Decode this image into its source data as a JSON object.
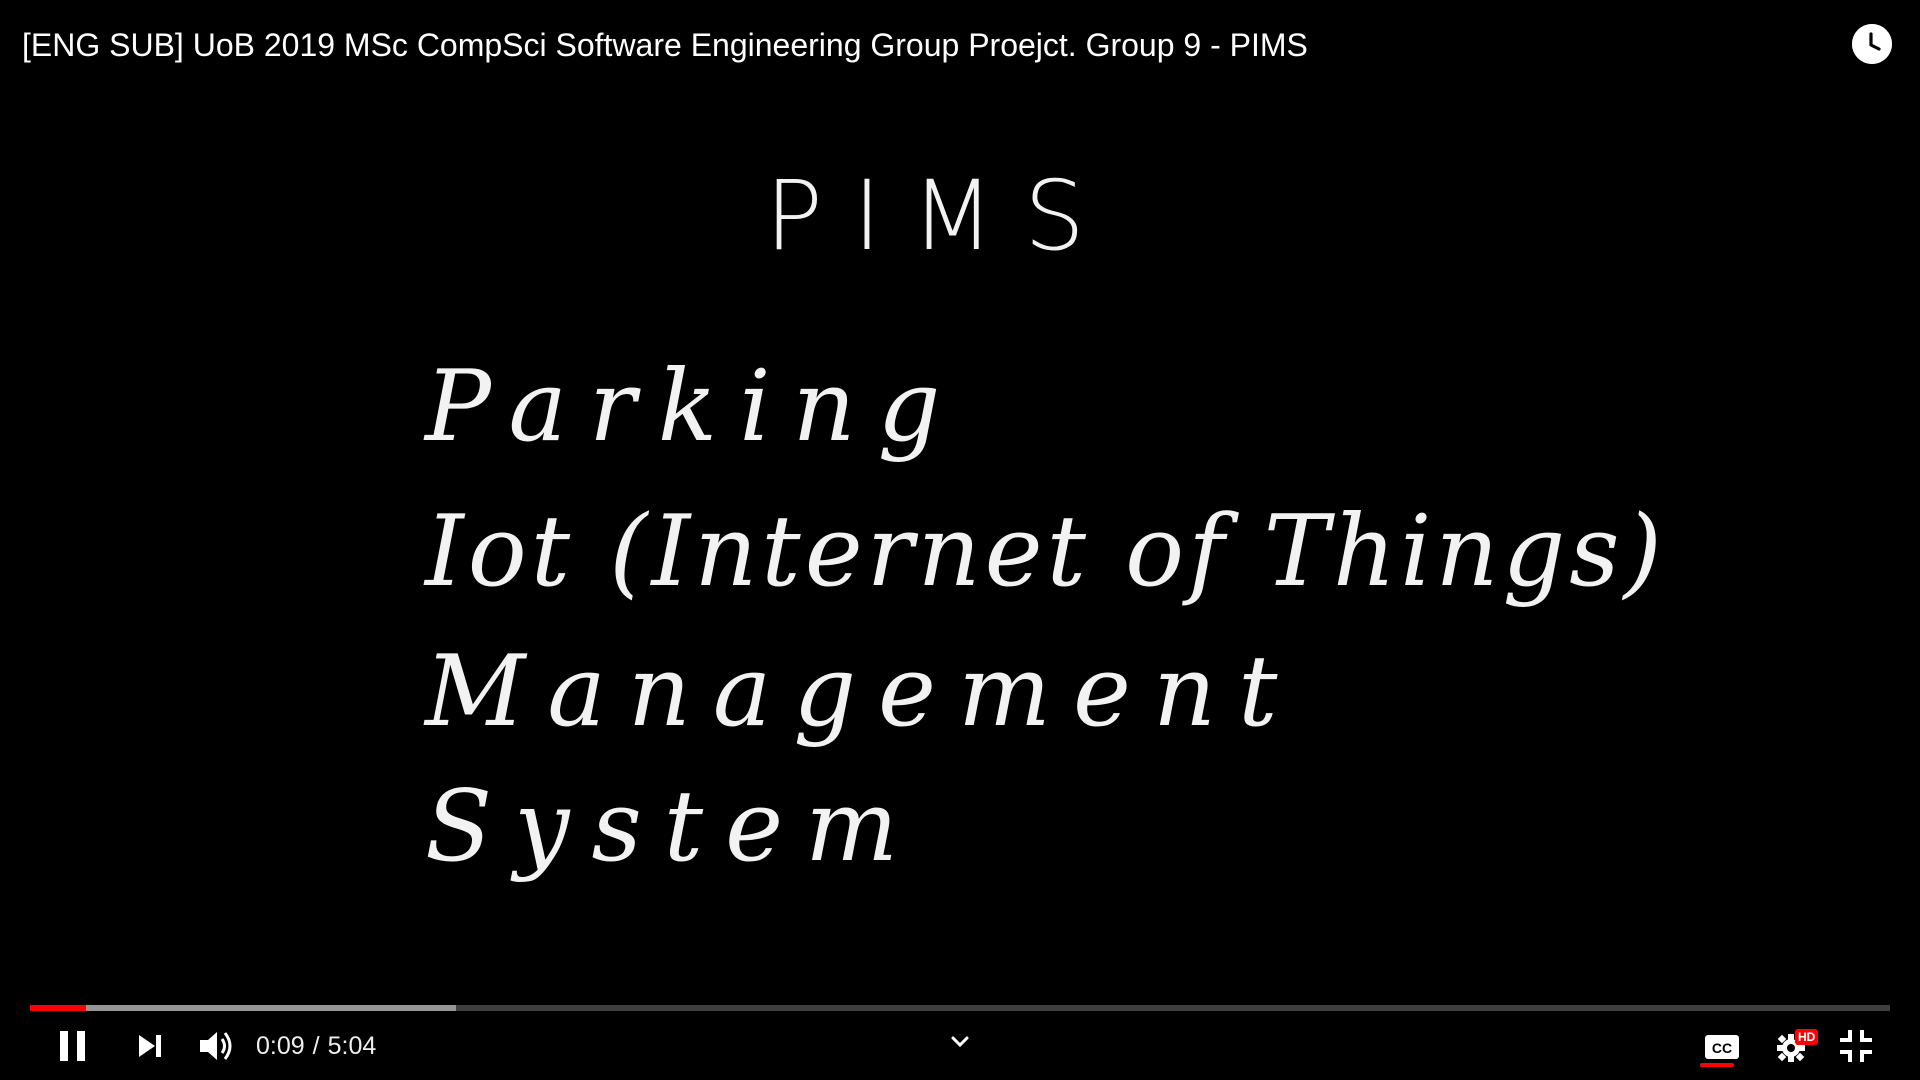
{
  "header": {
    "title": "[ENG SUB] UoB 2019 MSc CompSci Software Engineering Group Proejct. Group 9 - PIMS",
    "watch_later_icon": "clock-icon"
  },
  "slide": {
    "heading": "PIMS",
    "lines": [
      "Parking",
      "Iot (Internet of Things)",
      "Management",
      "System"
    ]
  },
  "player": {
    "current_time": "0:09",
    "separator": "/",
    "duration": "5:04",
    "played_fraction": 0.03,
    "buffered_fraction": 0.229,
    "colors": {
      "accent": "#ff0000",
      "icon": "#ffffff",
      "background": "#000000"
    },
    "icons": {
      "pause": "pause-icon",
      "next": "next-icon",
      "volume": "volume-icon",
      "chevron": "chevron-down-icon",
      "captions": "cc-icon",
      "settings": "gear-icon",
      "exit_fullscreen": "exit-fullscreen-icon"
    },
    "settings_badge": "HD"
  }
}
